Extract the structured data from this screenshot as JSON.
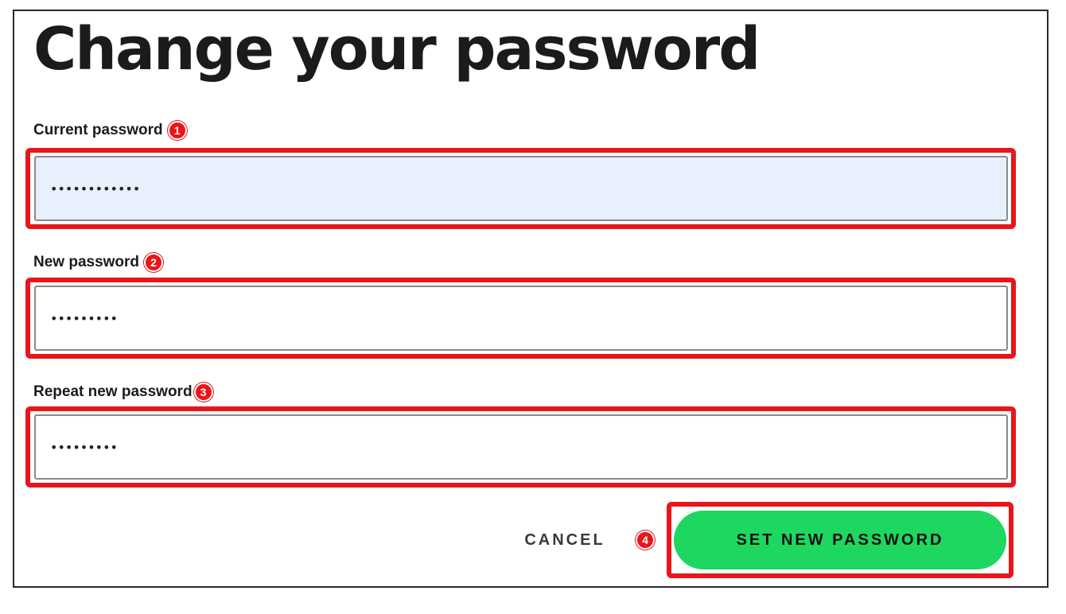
{
  "page": {
    "title": "Change your password"
  },
  "form": {
    "current_password": {
      "label": "Current password",
      "value": "••••••••••••",
      "marker": "1"
    },
    "new_password": {
      "label": "New password",
      "value": "•••••••••",
      "marker": "2"
    },
    "repeat_password": {
      "label": "Repeat new password",
      "value": "•••••••••",
      "marker": "3"
    }
  },
  "actions": {
    "cancel_label": "CANCEL",
    "submit_label": "SET NEW PASSWORD",
    "submit_marker": "4"
  },
  "colors": {
    "accent_green": "#1ed760",
    "highlight_red": "#e8161b",
    "autofill_blue": "#e8f0fe"
  }
}
